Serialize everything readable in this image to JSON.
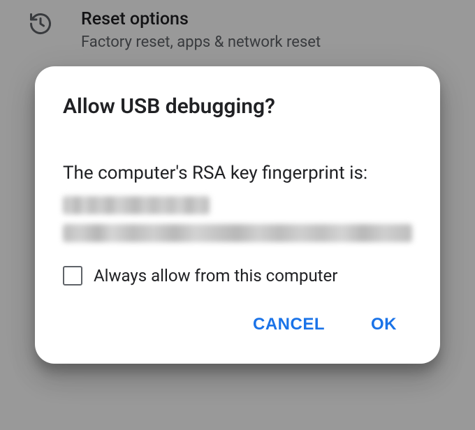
{
  "background_item": {
    "title": "Reset options",
    "subtitle": "Factory reset, apps & network reset",
    "icon": "history-icon"
  },
  "dialog": {
    "title": "Allow USB debugging?",
    "body": "The computer's RSA key fingerprint is:",
    "checkbox_label": "Always allow from this computer",
    "checkbox_checked": false,
    "cancel": "CANCEL",
    "ok": "OK"
  }
}
